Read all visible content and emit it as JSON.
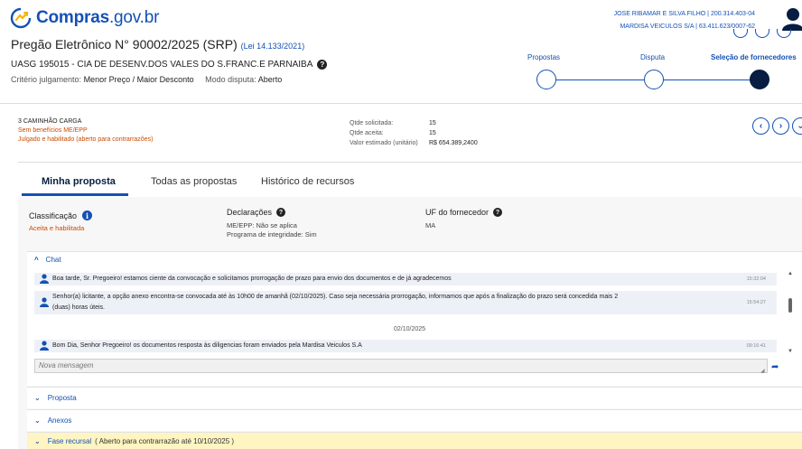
{
  "header": {
    "logo_bold": "Compras",
    "logo_light": ".gov.br",
    "user_line1": "JOSE RIBAMAR E SILVA FILHO | 200.314.403-04",
    "user_line2": "MARDISA VEICULOS S/A | 63.411.623/0007-62"
  },
  "title": {
    "main": "Pregão Eletrônico N° 90002/2025 (SRP)",
    "law": "(Lei 14.133/2021)",
    "uasg": "UASG 195015 - CIA DE DESENV.DOS VALES DO S.FRANC.E PARNAIBA",
    "criteria_label": "Critério julgamento:",
    "criteria_value": "Menor Preço / Maior Desconto",
    "mode_label": "Modo disputa:",
    "mode_value": "Aberto"
  },
  "stepper": {
    "steps": [
      "Propostas",
      "Disputa",
      "Seleção de fornecedores"
    ]
  },
  "item": {
    "name": "3  CAMINHÃO CARGA",
    "benefit": "Sem benefícios ME/EPP",
    "status": "Julgado e habilitado (aberto para contrarrazões)",
    "qty_requested_label": "Qtde solicitada:",
    "qty_requested": "15",
    "qty_accepted_label": "Qtde aceita:",
    "qty_accepted": "15",
    "est_value_label": "Valor estimado (unitário)",
    "est_value": "R$ 654.389,2400"
  },
  "tabs": [
    "Minha proposta",
    "Todas as propostas",
    "Histórico de recursos"
  ],
  "proposal": {
    "class_label": "Classificação",
    "class_value": "Aceita e habilitada",
    "decl_label": "Declarações",
    "decl_line1": "ME/EPP: Não se aplica",
    "decl_line2": "Programa de integridade: Sim",
    "uf_label": "UF do fornecedor",
    "uf_value": "MA"
  },
  "chat": {
    "title": "Chat",
    "messages": [
      {
        "text": "Boa tarde, Sr. Pregoeiro! estamos ciente da convocação e solicitamos prorrogação de prazo para envio dos documentos e de já agradecemos",
        "time": "15:32:04"
      },
      {
        "text": "Senhor(a) licitante, a opção anexo encontra-se convocada até às 10h00 de amanhã (02/10/2025). Caso seja necessária prorrogação, informamos que após a finalização do prazo será concedida mais 2",
        "text2": "(duas) horas úteis.",
        "time": "15:54:27"
      },
      {
        "text": "Bom Dia, Senhor Pregoeiro! os documentos resposta às diligencias foram enviados pela Mardisa Veiculos S.A",
        "time": "09:16:41"
      }
    ],
    "date_separator": "02/10/2025",
    "placeholder": "Nova mensagem"
  },
  "sections": {
    "proposta": "Proposta",
    "anexos": "Anexos",
    "fase": "Fase recursal",
    "fase_extra": "( Aberto para contrarrazão até 10/10/2025 )"
  }
}
